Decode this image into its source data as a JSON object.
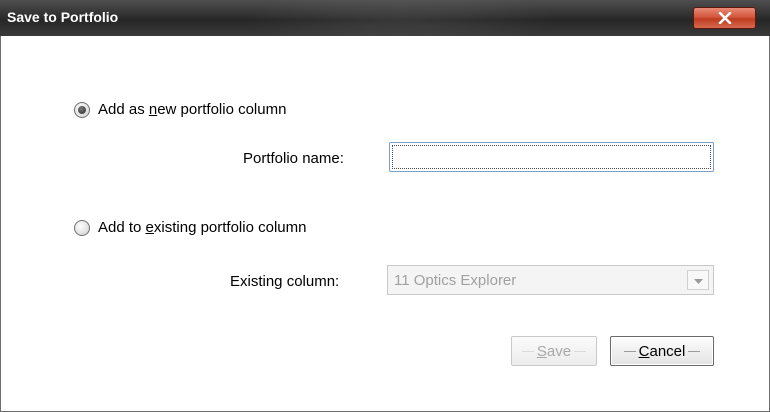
{
  "dialog": {
    "title": "Save to Portfolio",
    "close_glyph": "x"
  },
  "options": {
    "new_column": {
      "pre": "Add as ",
      "key": "n",
      "post": "ew portfolio column",
      "selected": true
    },
    "existing_column": {
      "pre": "Add to ",
      "key": "e",
      "post": "xisting portfolio column",
      "selected": false
    }
  },
  "fields": {
    "portfolio_name_label": "Portfolio name:",
    "portfolio_name_value": "",
    "existing_column_label": "Existing column:",
    "existing_column_value": "11 Optics Explorer"
  },
  "buttons": {
    "save": {
      "key": "S",
      "rest": "ave",
      "enabled": false
    },
    "cancel": {
      "key": "C",
      "rest": "ancel",
      "enabled": true
    }
  },
  "colors": {
    "titlebar": "#2f2f2f",
    "close_button": "#c9432a",
    "disabled_text": "#a0a0a0"
  },
  "icons": {
    "close": "close-icon",
    "dropdown": "chevron-down-icon"
  }
}
